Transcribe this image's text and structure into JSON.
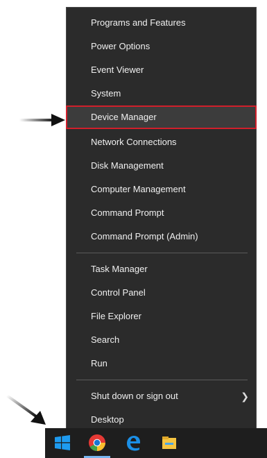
{
  "menu": {
    "items": [
      {
        "label": "Programs and Features"
      },
      {
        "label": "Power Options"
      },
      {
        "label": "Event Viewer"
      },
      {
        "label": "System"
      },
      {
        "label": "Device Manager"
      },
      {
        "label": "Network Connections"
      },
      {
        "label": "Disk Management"
      },
      {
        "label": "Computer Management"
      },
      {
        "label": "Command Prompt"
      },
      {
        "label": "Command Prompt (Admin)"
      },
      {
        "label": "Task Manager"
      },
      {
        "label": "Control Panel"
      },
      {
        "label": "File Explorer"
      },
      {
        "label": "Search"
      },
      {
        "label": "Run"
      },
      {
        "label": "Shut down or sign out"
      },
      {
        "label": "Desktop"
      }
    ],
    "highlighted_item": "Device Manager",
    "highlight_color": "#d11f2b",
    "background_color": "#2b2b2b"
  },
  "taskbar": {
    "icons": [
      "windows-start-icon",
      "chrome-icon",
      "edge-icon",
      "file-explorer-icon"
    ],
    "background_color": "#1e1e1e"
  }
}
